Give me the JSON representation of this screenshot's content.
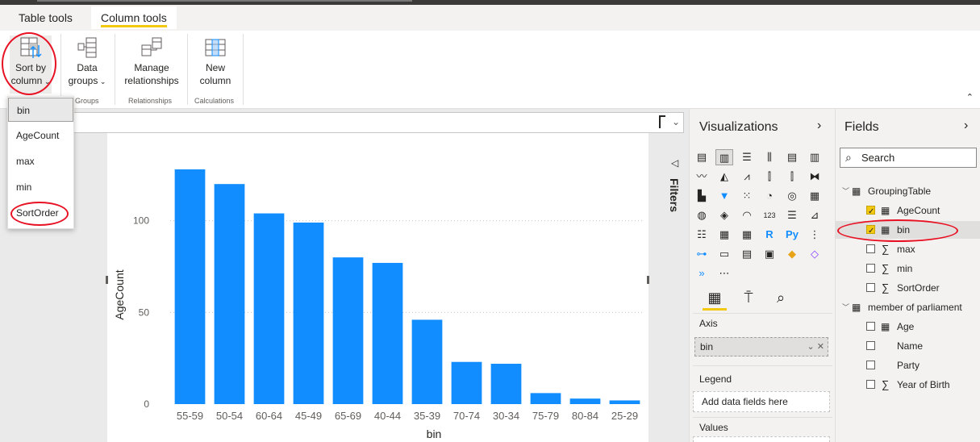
{
  "ribbon": {
    "tabs": [
      "Table tools",
      "Column tools"
    ],
    "active_tab": 1,
    "buttons": {
      "sort_line1": "Sort by",
      "sort_line2": "column",
      "data_groups_line1": "Data",
      "data_groups_line2": "groups",
      "manage_line1": "Manage",
      "manage_line2": "relationships",
      "new_col_line1": "New",
      "new_col_line2": "column"
    },
    "groups": [
      "Groups",
      "Relationships",
      "Calculations"
    ]
  },
  "sort_menu": {
    "items": [
      "bin",
      "AgeCount",
      "max",
      "min",
      "SortOrder"
    ],
    "selected": "bin"
  },
  "filters": {
    "label": "Filters"
  },
  "visualizations": {
    "title": "Visualizations",
    "wells": {
      "axis_label": "Axis",
      "axis_value": "bin",
      "legend_label": "Legend",
      "legend_placeholder": "Add data fields here",
      "values_label": "Values"
    }
  },
  "fields": {
    "title": "Fields",
    "search_placeholder": "Search",
    "tables": [
      {
        "name": "GroupingTable",
        "fields": [
          {
            "name": "AgeCount",
            "checked": true,
            "sigma": false
          },
          {
            "name": "bin",
            "checked": true,
            "sigma": false
          },
          {
            "name": "max",
            "checked": false,
            "sigma": true
          },
          {
            "name": "min",
            "checked": false,
            "sigma": true
          },
          {
            "name": "SortOrder",
            "checked": false,
            "sigma": true
          }
        ]
      },
      {
        "name": "member of parliament",
        "fields": [
          {
            "name": "Age",
            "checked": false,
            "sigma": false
          },
          {
            "name": "Name",
            "checked": false,
            "sigma": false
          },
          {
            "name": "Party",
            "checked": false,
            "sigma": false
          },
          {
            "name": "Year of Birth",
            "checked": false,
            "sigma": true
          }
        ]
      }
    ]
  },
  "colors": {
    "bar": "#118dff",
    "accent": "#f2c811",
    "annotation": "#e81123"
  },
  "chart_data": {
    "type": "bar",
    "categories": [
      "55-59",
      "50-54",
      "60-64",
      "45-49",
      "65-69",
      "40-44",
      "35-39",
      "70-74",
      "30-34",
      "75-79",
      "80-84",
      "25-29"
    ],
    "values": [
      128,
      120,
      104,
      99,
      80,
      77,
      46,
      23,
      22,
      6,
      3,
      2
    ],
    "xlabel": "bin",
    "ylabel": "AgeCount",
    "yticks": [
      0,
      50,
      100
    ],
    "ylim": [
      0,
      128
    ],
    "grid": true
  }
}
